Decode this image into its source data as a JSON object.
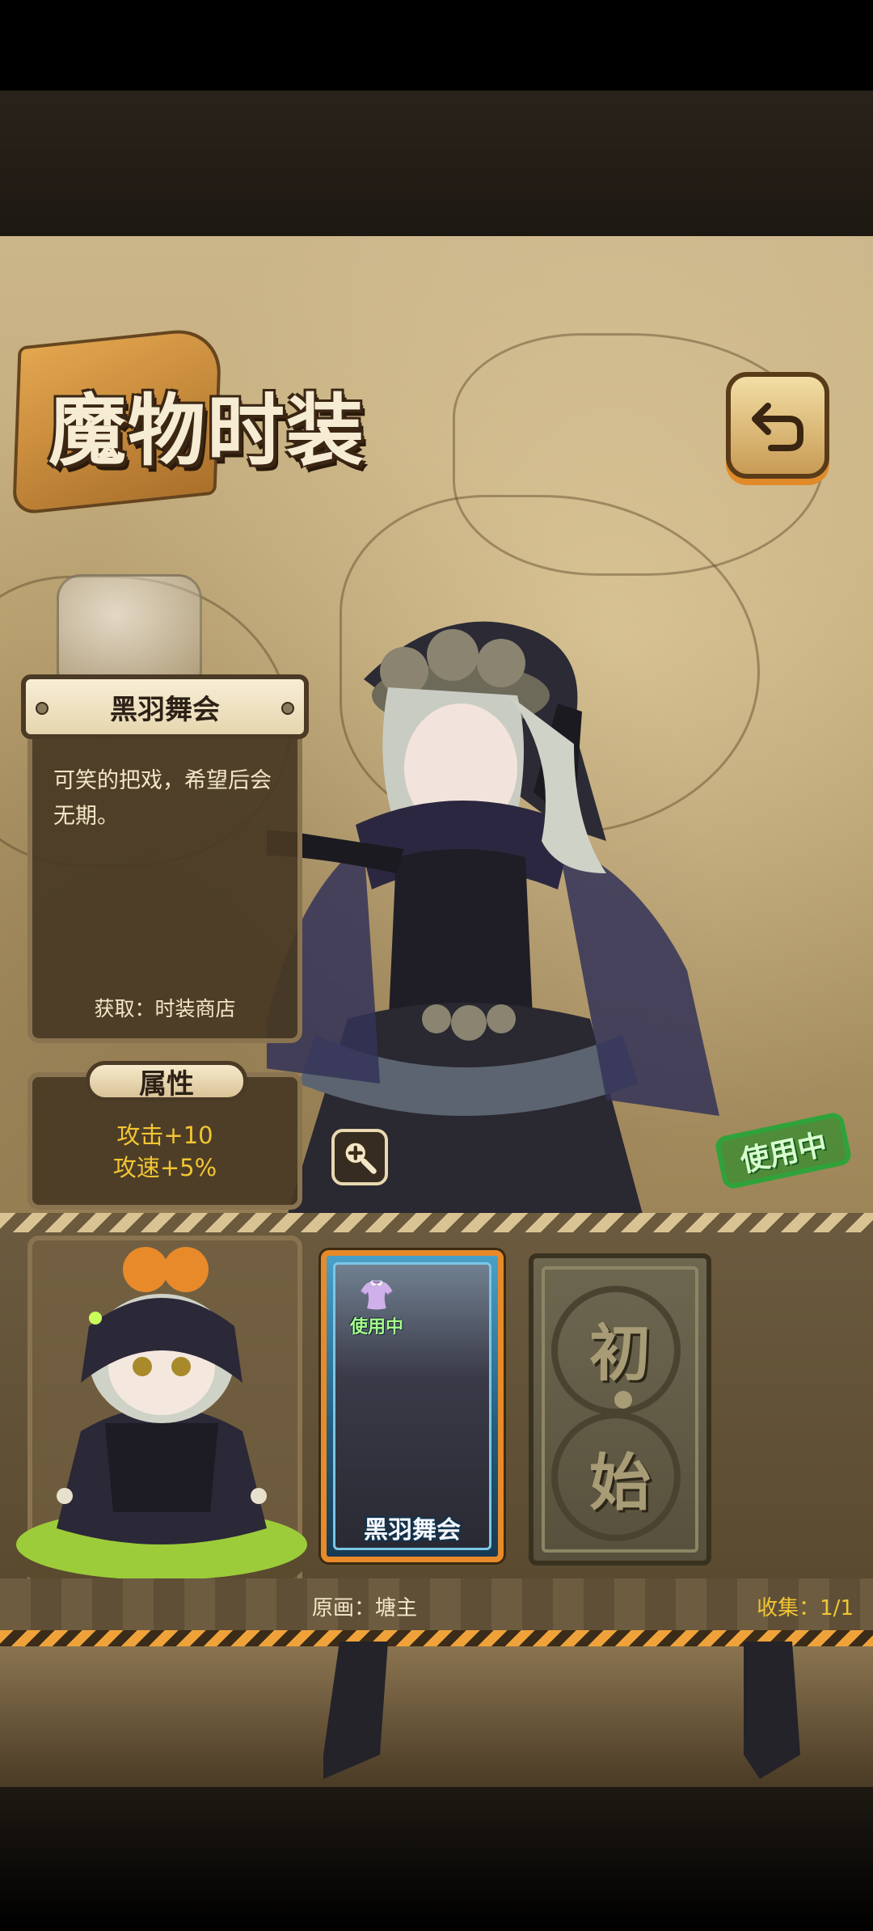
{
  "header": {
    "title": "魔物时装"
  },
  "outfit": {
    "name": "黑羽舞会",
    "description": "可笑的把戏，希望后会无期。",
    "obtain": "获取：时装商店"
  },
  "attributes": {
    "tag": "属性",
    "lines": [
      "攻击+10",
      "攻速+5%"
    ]
  },
  "stamp": {
    "label": "使用中"
  },
  "cards": [
    {
      "name": "黑羽舞会",
      "status": "使用中",
      "selected": true
    },
    {
      "name": "初·始",
      "chars": [
        "初",
        "始"
      ],
      "selected": false
    }
  ],
  "footer": {
    "artist": "原画：塘主",
    "collect": "收集：1/1"
  },
  "icons": {
    "back": "back-arrow-icon",
    "zoom": "zoom-in-icon",
    "shirt": "shirt-icon"
  },
  "colors": {
    "accent_orange": "#e88a2a",
    "attr_yellow": "#f2c533",
    "stamp_green": "#2fa33a"
  }
}
